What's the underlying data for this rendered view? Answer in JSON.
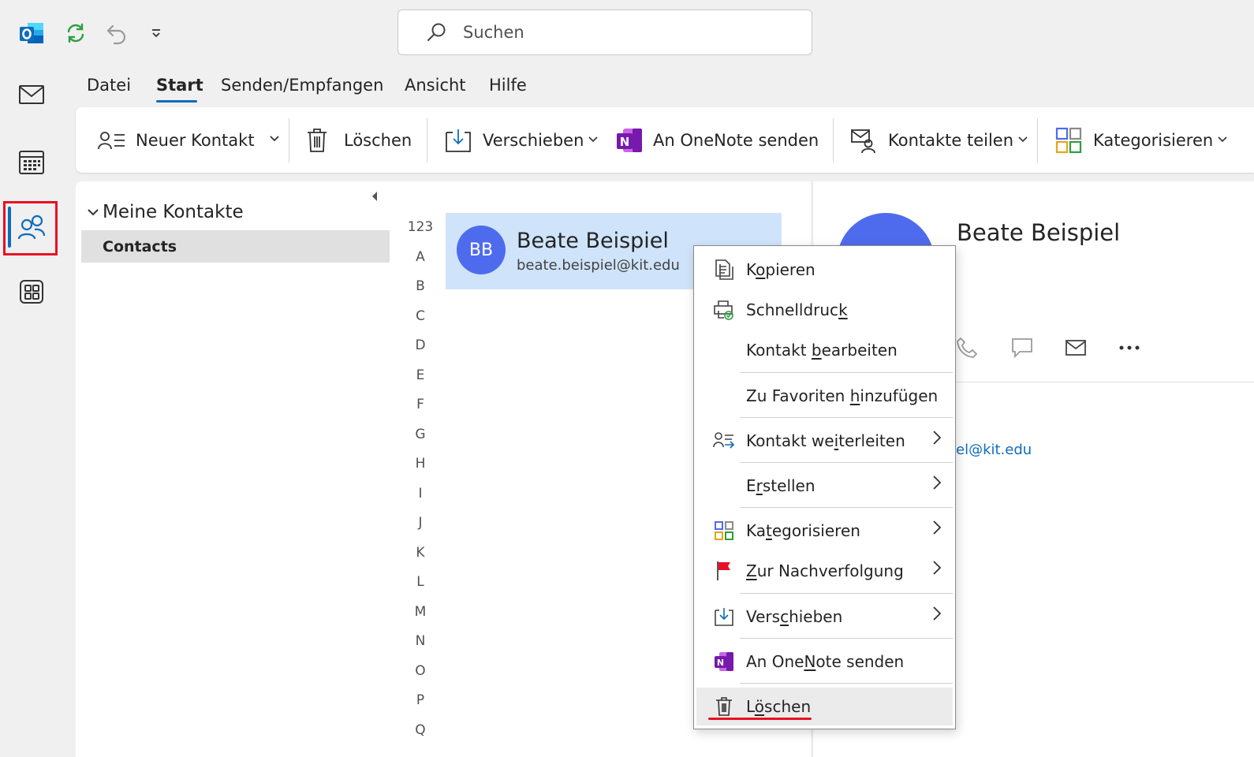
{
  "titlebar": {
    "search_placeholder": "Suchen"
  },
  "menu_tabs": [
    "Datei",
    "Start",
    "Senden/Empfangen",
    "Ansicht",
    "Hilfe"
  ],
  "ribbon": {
    "new_contact": "Neuer Kontakt",
    "delete": "Löschen",
    "move": "Verschieben",
    "onenote": "An OneNote senden",
    "share": "Kontakte teilen",
    "categorize": "Kategorisieren"
  },
  "folders": {
    "header": "Meine Kontakte",
    "items": [
      "Contacts"
    ]
  },
  "alphabet": [
    "123",
    "A",
    "B",
    "C",
    "D",
    "E",
    "F",
    "G",
    "H",
    "I",
    "J",
    "K",
    "L",
    "M",
    "N",
    "O",
    "P",
    "Q"
  ],
  "contact": {
    "initials": "BB",
    "name": "Beate Beispiel",
    "email": "beate.beispiel@kit.edu",
    "email_partial": "iel@kit.edu"
  },
  "context_menu": {
    "copy_pre": "K",
    "copy_key": "o",
    "copy_post": "pieren",
    "print_pre": "Schnelldruc",
    "print_key": "k",
    "print_post": "",
    "edit_pre": "Kontakt ",
    "edit_key": "b",
    "edit_post": "earbeiten",
    "fav_pre": "Zu Favoriten ",
    "fav_key": "h",
    "fav_post": "inzufügen",
    "fwd_pre": "Kontakt we",
    "fwd_key": "i",
    "fwd_post": "terleiten",
    "create_pre": "E",
    "create_key": "r",
    "create_post": "stellen",
    "cat_pre": "Ka",
    "cat_key": "t",
    "cat_post": "egorisieren",
    "follow_pre": "",
    "follow_key": "Z",
    "follow_post": "ur Nachverfolgung",
    "move_pre": "Vers",
    "move_key": "c",
    "move_post": "hieben",
    "onenote_pre": "An One",
    "onenote_key": "N",
    "onenote_post": "ote senden",
    "delete_pre": "L",
    "delete_key": "ö",
    "delete_post": "schen"
  },
  "colors": {
    "accent": "#0f6cbd",
    "avatar": "#4f6bed",
    "selection": "#cfe4fa",
    "highlight_red": "#e81123"
  }
}
